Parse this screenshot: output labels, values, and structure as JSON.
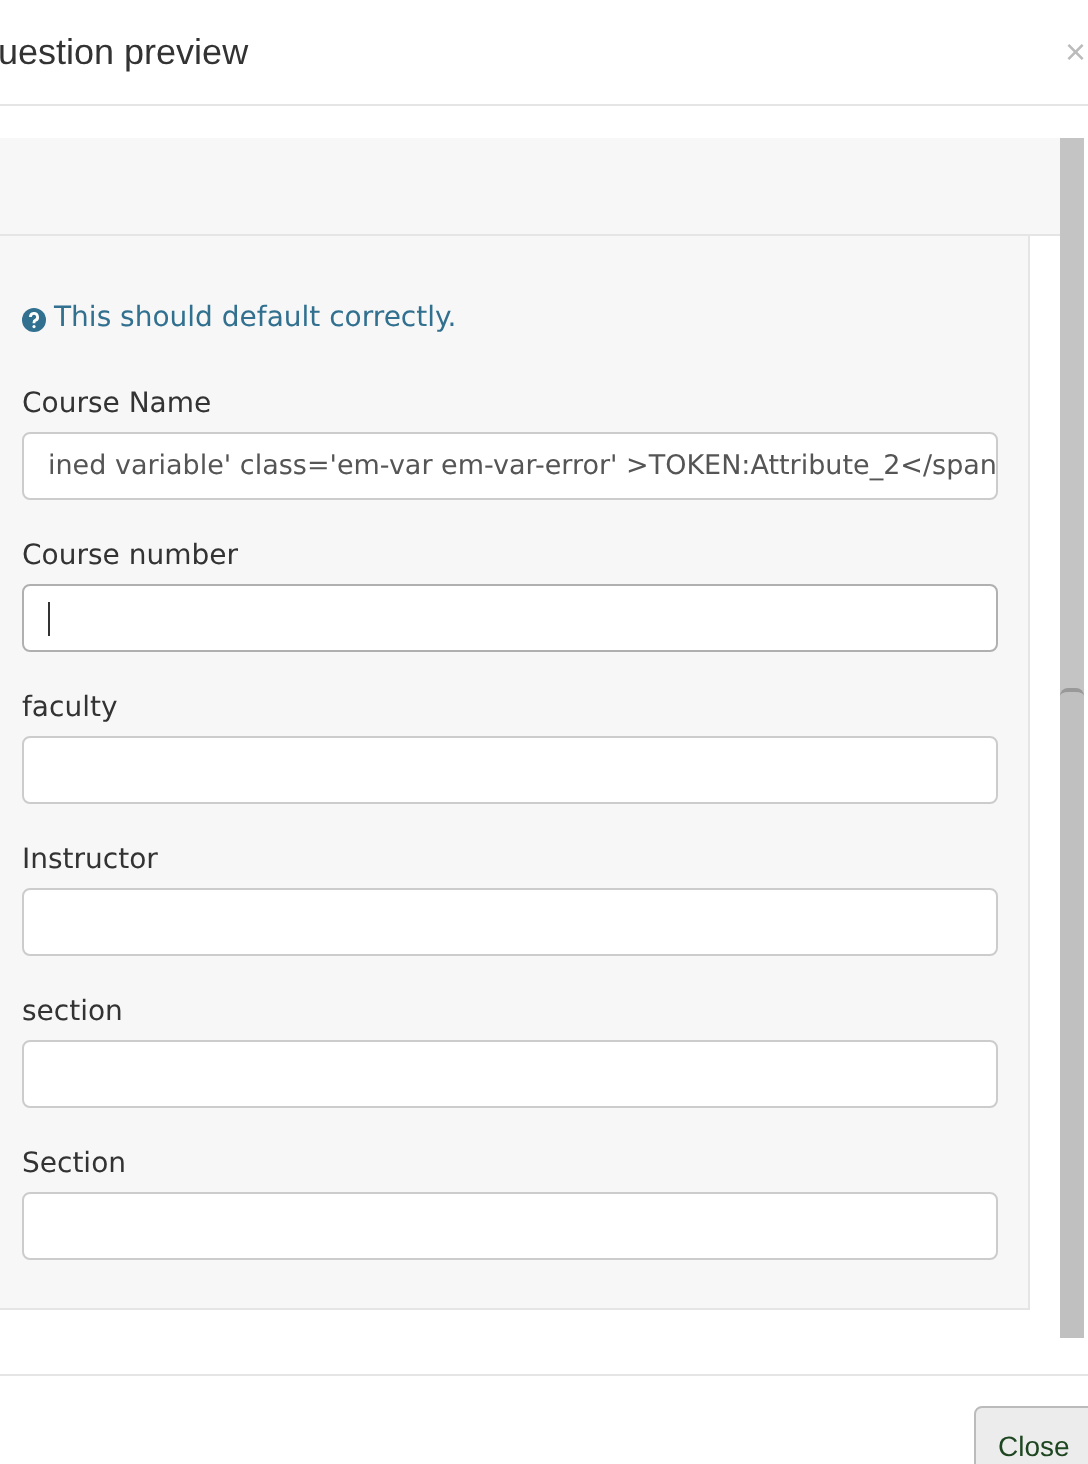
{
  "dialog": {
    "title": "uestion preview",
    "close_icon": "×"
  },
  "section": {
    "help_text": "This should default correctly."
  },
  "fields": [
    {
      "label": "Course Name",
      "value": "ined variable' class='em-var em-var-error' >TOKEN:Attribute_2</span",
      "focused": false
    },
    {
      "label": "Course number",
      "focused": true
    },
    {
      "label": "faculty",
      "focused": false
    },
    {
      "label": "Instructor",
      "focused": false
    },
    {
      "label": "section",
      "focused": false
    },
    {
      "label": "Section",
      "focused": false
    }
  ],
  "footer": {
    "button": "Close"
  }
}
